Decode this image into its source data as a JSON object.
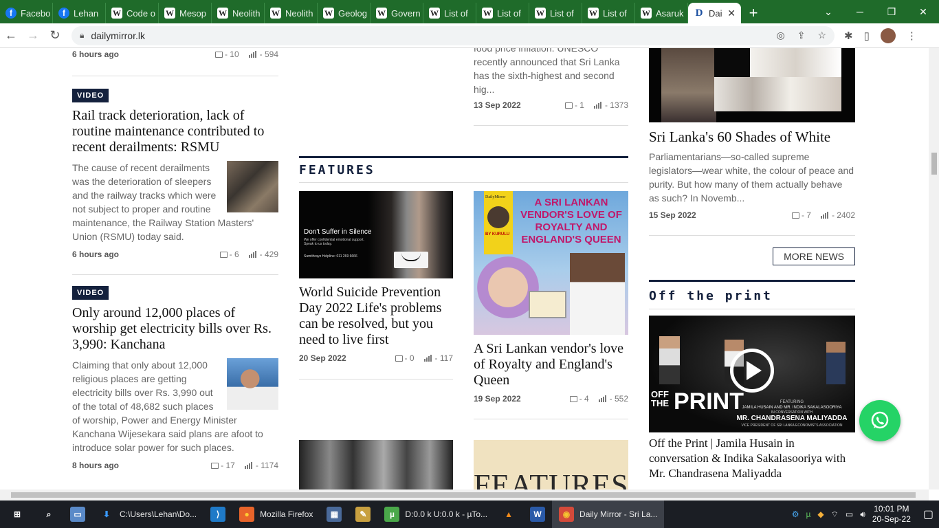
{
  "browser": {
    "tabs": [
      {
        "label": "Facebo",
        "icon": "facebook-icon",
        "glyph": "f"
      },
      {
        "label": "Lehan",
        "icon": "facebook-icon",
        "glyph": "f"
      },
      {
        "label": "Code o",
        "icon": "wikipedia-icon",
        "glyph": "W"
      },
      {
        "label": "Mesop",
        "icon": "wikipedia-icon",
        "glyph": "W"
      },
      {
        "label": "Neolith",
        "icon": "wikipedia-icon",
        "glyph": "W"
      },
      {
        "label": "Neolith",
        "icon": "wikipedia-icon",
        "glyph": "W"
      },
      {
        "label": "Geolog",
        "icon": "wikipedia-icon",
        "glyph": "W"
      },
      {
        "label": "Govern",
        "icon": "wikipedia-icon",
        "glyph": "W"
      },
      {
        "label": "List of",
        "icon": "wikipedia-icon",
        "glyph": "W"
      },
      {
        "label": "List of",
        "icon": "wikipedia-icon",
        "glyph": "W"
      },
      {
        "label": "List of",
        "icon": "wikipedia-icon",
        "glyph": "W"
      },
      {
        "label": "List of",
        "icon": "wikipedia-icon",
        "glyph": "W"
      },
      {
        "label": "Asaruk",
        "icon": "wikipedia-icon",
        "glyph": "W"
      }
    ],
    "active_tab": {
      "label": "Dai",
      "glyph": "D",
      "close": "✕"
    },
    "new_tab": "+",
    "url": "dailymirror.lk",
    "window": {
      "minimize": "─",
      "maximize": "❐",
      "close": "✕",
      "dropdown": "⌄"
    }
  },
  "col1": {
    "top_meta": {
      "date": "6 hours ago",
      "comments": "- 10",
      "views": "- 594"
    },
    "articles": [
      {
        "badge": "VIDEO",
        "title": "Rail track deterioration, lack of routine maintenance contributed to recent derailments: RSMU",
        "excerpt": "The cause of recent derailments was the deterioration of sleepers and the railway tracks which were not subject to proper and routine maintenance, the Railway Station Masters' Union (RSMU) today said.",
        "date": "6 hours ago",
        "comments": "- 6",
        "views": "- 429"
      },
      {
        "badge": "VIDEO",
        "title": "Only around 12,000 places of worship get electricity bills over Rs. 3,990: Kanchana",
        "excerpt": "Claiming that only about 12,000 religious places are getting electricity bills over Rs. 3,990 out of the total of 48,682 such places of worship, Power and Energy Minister Kanchana Wijesekara said plans are afoot to introduce solar power for such places.",
        "date": "8 hours ago",
        "comments": "- 17",
        "views": "- 1174"
      }
    ]
  },
  "col2": {
    "top_excerpt": "food price inflation. UNESCO recently announced that Sri Lanka has the sixth-highest and second hig...",
    "top_meta": {
      "date": "13 Sep 2022",
      "comments": "- 1",
      "views": "- 1373"
    },
    "section_title": "FEATURES",
    "features": [
      {
        "title": "World Suicide Prevention Day 2022 Life's problems can be resolved, but you need to live first",
        "date": "20 Sep 2022",
        "comments": "- 0",
        "views": "- 117",
        "img_text": "Don't Suffer in Silence",
        "img_sub": "We offer confidential emotional support. Speak to us today.",
        "img_helpline": "Sumithrayo Helpline: 011 269 6666"
      },
      {
        "title": "A Sri Lankan vendor's love of Royalty and England's Queen",
        "date": "19 Sep 2022",
        "comments": "- 4",
        "views": "- 552",
        "img_heading": "A SRI LANKAN VENDOR'S LOVE OF ROYALTY AND ENGLAND'S QUEEN",
        "img_brand": "DailyMirror",
        "img_author": "BY KURULU"
      }
    ],
    "bottom_img_text": "FEATURES"
  },
  "col3": {
    "top_title": "Sri Lanka's 60 Shades of White",
    "top_excerpt": "Parliamentarians—so-called supreme legislators—wear white, the colour of peace and purity. But how many of them actually behave as such? In Novemb...",
    "top_meta": {
      "date": "15 Sep 2022",
      "comments": "- 7",
      "views": "- 2402"
    },
    "more_news": "MORE NEWS",
    "section_title": "Off the print",
    "video": {
      "logo_line1": "OFF",
      "logo_line2": "THE",
      "logo_big": "PRINT",
      "featuring": "FEATURING",
      "guests": "JAMILA HUSAIN AND MR. INDIKA SAKALASOORIYA",
      "in_conv": "IN CONVERSATION WITH",
      "main_guest": "MR. CHANDRASENA MALIYADDA",
      "role": "VICE PRESIDENT OF SRI LANKA ECONOMISTS ASSOCIATION"
    },
    "video_title": "Off the Print | Jamila Husain in conversation & Indika Sakalasooriya with Mr. Chandrasena Maliyadda"
  },
  "taskbar": {
    "items": [
      {
        "label": "",
        "icon": "windows-start-icon"
      },
      {
        "label": "",
        "icon": "search-icon"
      },
      {
        "label": "",
        "icon": "desktop-icon"
      },
      {
        "label": "C:\\Users\\Lehan\\Do...",
        "icon": "download-folder-icon"
      },
      {
        "label": "",
        "icon": "vscode-icon"
      },
      {
        "label": "Mozilla Firefox",
        "icon": "firefox-icon"
      },
      {
        "label": "",
        "icon": "calculator-icon"
      },
      {
        "label": "",
        "icon": "paint-icon"
      },
      {
        "label": "D:0.0 k U:0.0 k - µTo...",
        "icon": "utorrent-icon"
      },
      {
        "label": "",
        "icon": "vlc-icon"
      },
      {
        "label": "",
        "icon": "word-icon"
      },
      {
        "label": "Daily Mirror - Sri La...",
        "icon": "chrome-icon"
      }
    ],
    "time": "10:01 PM",
    "date": "20-Sep-22"
  },
  "colors": {
    "navy": "#14213d",
    "green_tabs": "#1f6b2a",
    "whatsapp": "#25d366"
  }
}
